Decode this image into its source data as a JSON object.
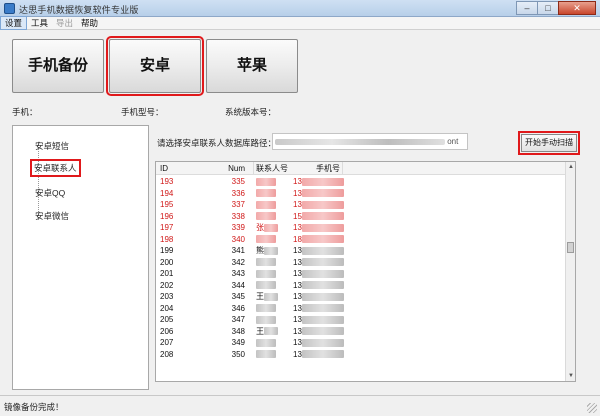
{
  "window": {
    "title": "达思手机数据恢复软件专业版",
    "minimize": "–",
    "maximize": "□",
    "close": "✕"
  },
  "menu": [
    "设置",
    "工具",
    "导出",
    "帮助"
  ],
  "big_buttons": [
    "手机备份",
    "安卓",
    "苹果"
  ],
  "info": {
    "phone_label": "手机：",
    "model_label": "手机型号：",
    "system_label": "系统版本号："
  },
  "tree": [
    "安卓短信",
    "安卓联系人",
    "安卓QQ",
    "安卓微信"
  ],
  "path": {
    "label": "请选择安卓联系人数据库路径：",
    "value_suffix": "ont"
  },
  "scan_button": "开始手动扫描",
  "grid": {
    "headers": [
      "ID",
      "Num",
      "联系人号",
      "手机号"
    ],
    "rows": [
      {
        "id": "193",
        "num": "335",
        "contact": "",
        "phone": "13",
        "red": true
      },
      {
        "id": "194",
        "num": "336",
        "contact": "",
        "phone": "13",
        "red": true
      },
      {
        "id": "195",
        "num": "337",
        "contact": "",
        "phone": "13",
        "red": true
      },
      {
        "id": "196",
        "num": "338",
        "contact": "",
        "phone": "15",
        "red": true
      },
      {
        "id": "197",
        "num": "339",
        "contact": "张",
        "phone": "13",
        "red": true
      },
      {
        "id": "198",
        "num": "340",
        "contact": "",
        "phone": "18",
        "red": true
      },
      {
        "id": "199",
        "num": "341",
        "contact": "熊",
        "phone": "13",
        "red": false
      },
      {
        "id": "200",
        "num": "342",
        "contact": "",
        "phone": "13",
        "red": false
      },
      {
        "id": "201",
        "num": "343",
        "contact": "",
        "phone": "13",
        "red": false
      },
      {
        "id": "202",
        "num": "344",
        "contact": "",
        "phone": "13",
        "red": false
      },
      {
        "id": "203",
        "num": "345",
        "contact": "王",
        "phone": "13",
        "red": false
      },
      {
        "id": "204",
        "num": "346",
        "contact": "",
        "phone": "13",
        "red": false
      },
      {
        "id": "205",
        "num": "347",
        "contact": "",
        "phone": "13",
        "red": false
      },
      {
        "id": "206",
        "num": "348",
        "contact": "王",
        "phone": "13",
        "red": false
      },
      {
        "id": "207",
        "num": "349",
        "contact": "",
        "phone": "13",
        "red": false
      },
      {
        "id": "208",
        "num": "350",
        "contact": "",
        "phone": "13",
        "red": false
      }
    ]
  },
  "status": "镜像备份完成！",
  "colors": {
    "highlight_red": "#e0191b",
    "deleted_row_text": "#d01818"
  }
}
